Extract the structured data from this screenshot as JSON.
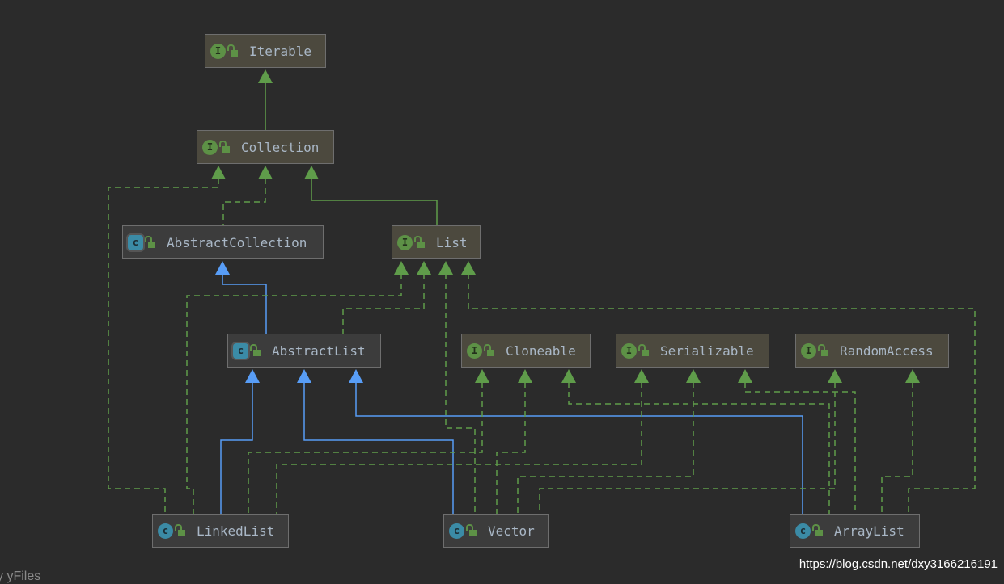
{
  "nodes": [
    {
      "id": "iterable",
      "label": "Iterable",
      "kind": "interface"
    },
    {
      "id": "collection",
      "label": "Collection",
      "kind": "interface"
    },
    {
      "id": "abstractcollection",
      "label": "AbstractCollection",
      "kind": "abstract-class"
    },
    {
      "id": "list",
      "label": "List",
      "kind": "interface"
    },
    {
      "id": "abstractlist",
      "label": "AbstractList",
      "kind": "abstract-class"
    },
    {
      "id": "cloneable",
      "label": "Cloneable",
      "kind": "interface"
    },
    {
      "id": "serializable",
      "label": "Serializable",
      "kind": "interface"
    },
    {
      "id": "randomaccess",
      "label": "RandomAccess",
      "kind": "interface"
    },
    {
      "id": "linkedlist",
      "label": "LinkedList",
      "kind": "class"
    },
    {
      "id": "vector",
      "label": "Vector",
      "kind": "class"
    },
    {
      "id": "arraylist",
      "label": "ArrayList",
      "kind": "class"
    }
  ],
  "icons": {
    "interface": "I",
    "class": "c"
  },
  "colors": {
    "implements": "#5f9c4a",
    "extends": "#589df6",
    "background": "#2b2b2b"
  },
  "watermark": "https://blog.csdn.net/dxy3166216191",
  "footer": "y yFiles"
}
